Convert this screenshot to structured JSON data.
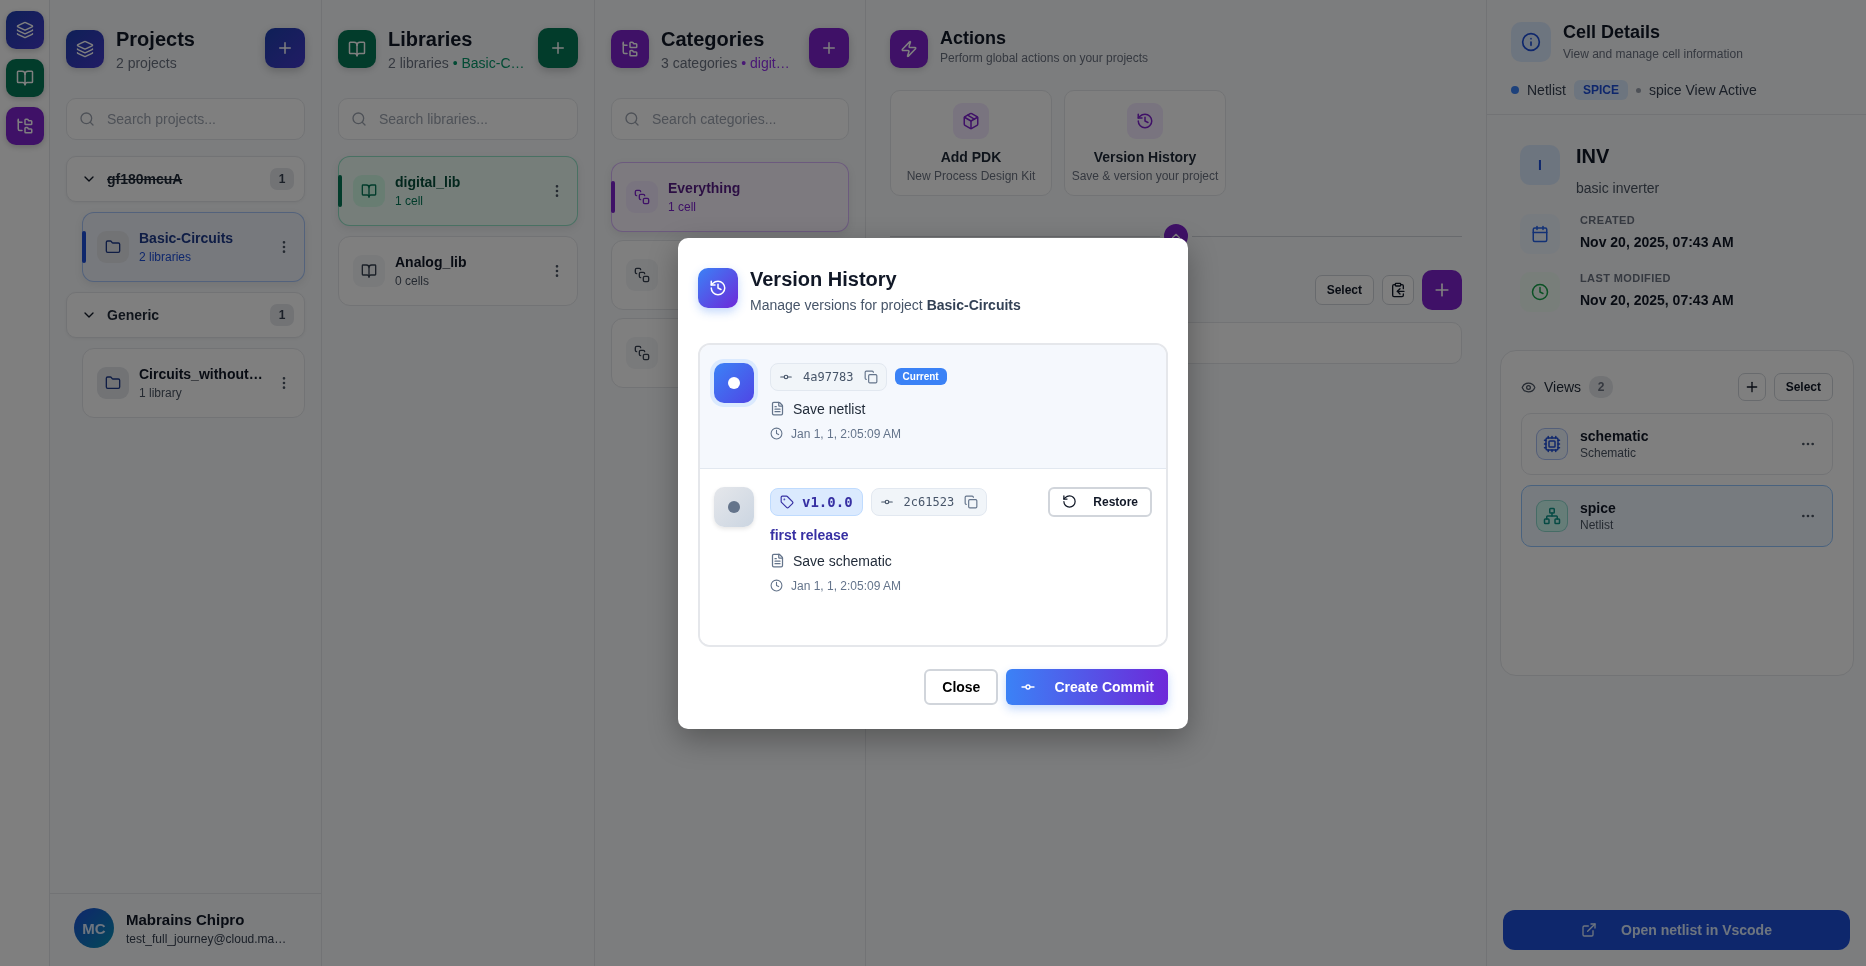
{
  "projects": {
    "title": "Projects",
    "subtitle": "2 projects",
    "search": {
      "placeholder": "Search projects..."
    },
    "groups": [
      {
        "name": "gf180mcuA",
        "strikethrough": true,
        "count": "1",
        "expanded": true,
        "items": [
          {
            "name": "Basic-Circuits",
            "meta": "2 libraries",
            "selected": true
          }
        ]
      },
      {
        "name": "Generic",
        "strikethrough": false,
        "count": "1",
        "expanded": true,
        "items": [
          {
            "name": "Circuits_without…",
            "meta": "1 library",
            "selected": false
          }
        ]
      }
    ]
  },
  "user": {
    "initials": "MC",
    "name": "Mabrains Chipro",
    "email": "test_full_journey@cloud.ma…"
  },
  "libraries": {
    "title": "Libraries",
    "subtitle": "2 libraries",
    "context": "• Basic-C…",
    "search": {
      "placeholder": "Search libraries..."
    },
    "items": [
      {
        "name": "digital_lib",
        "meta": "1 cell",
        "selected": true
      },
      {
        "name": "Analog_lib",
        "meta": "0 cells",
        "selected": false
      }
    ]
  },
  "categories": {
    "title": "Categories",
    "subtitle": "3 categories",
    "context": "• digit…",
    "search": {
      "placeholder": "Search categories..."
    },
    "items": [
      {
        "name": "Everything",
        "meta": "1 cell",
        "selected": true
      },
      {
        "selected": false
      },
      {
        "selected": false
      }
    ]
  },
  "actions": {
    "title": "Actions",
    "subtitle": "Perform global actions on your projects",
    "cards": [
      {
        "kind": "package",
        "title": "Add PDK",
        "subtitle": "New Process Design Kit"
      },
      {
        "kind": "history",
        "title": "Version History",
        "subtitle": "Save & version your project"
      }
    ],
    "select_button": "Select"
  },
  "cell_details": {
    "title": "Cell Details",
    "subtitle": "View and manage cell information",
    "view_type": "Netlist",
    "format": "SPICE",
    "active": "spice View Active",
    "cell": {
      "initial": "I",
      "name": "INV",
      "description": "basic inverter"
    },
    "created_label": "CREATED",
    "created": "Nov 20, 2025, 07:43 AM",
    "modified_label": "LAST MODIFIED",
    "modified": "Nov 20, 2025, 07:43 AM",
    "views": {
      "title": "Views",
      "count": "2",
      "select_button": "Select",
      "items": [
        {
          "kind": "schematic",
          "name": "schematic",
          "type": "Schematic",
          "selected": false
        },
        {
          "kind": "netlist",
          "name": "spice",
          "type": "Netlist",
          "selected": true
        }
      ]
    },
    "open_button": "Open netlist in Vscode"
  },
  "dialog": {
    "title": "Version History",
    "subtitle": "Manage versions for project **Basic-Circuits**",
    "commits": [
      {
        "hash": "4a97783",
        "current": true,
        "current_label": "Current",
        "message": "Save netlist",
        "time": "Jan 1, 1, 2:05:09 AM"
      },
      {
        "hash": "2c61523",
        "current": false,
        "tag": "v1.0.0",
        "tag_message": "first release",
        "message": "Save schematic",
        "time": "Jan 1, 1, 2:05:09 AM",
        "restore_label": "Restore"
      }
    ],
    "close_button": "Close",
    "commit_button": "Create Commit"
  }
}
